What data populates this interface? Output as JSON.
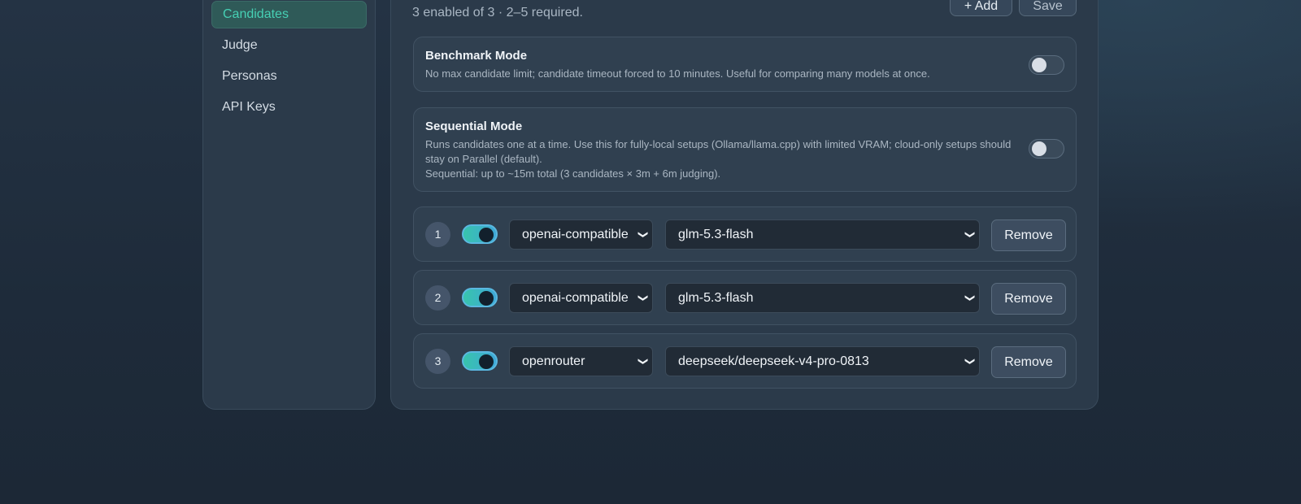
{
  "sidebar": {
    "items": [
      {
        "label": "Candidates",
        "active": true
      },
      {
        "label": "Judge"
      },
      {
        "label": "Personas"
      },
      {
        "label": "API Keys"
      }
    ]
  },
  "header": {
    "summary": "3 enabled of 3 · 2–5 required.",
    "add_label": "+ Add",
    "save_label": "Save"
  },
  "benchmark_mode": {
    "title": "Benchmark Mode",
    "description": "No max candidate limit; candidate timeout forced to 10 minutes. Useful for comparing many models at once.",
    "enabled": false
  },
  "sequential_mode": {
    "title": "Sequential Mode",
    "description": "Runs candidates one at a time. Use this for fully-local setups (Ollama/llama.cpp) with limited VRAM; cloud-only setups should stay on Parallel (default).",
    "estimate": "Sequential: up to ~15m total (3 candidates × 3m + 6m judging).",
    "enabled": false
  },
  "candidates": [
    {
      "number": "1",
      "enabled": true,
      "provider": "openai-compatible",
      "model": "glm-5.3-flash",
      "remove_label": "Remove"
    },
    {
      "number": "2",
      "enabled": true,
      "provider": "openai-compatible",
      "model": "glm-5.3-flash",
      "remove_label": "Remove"
    },
    {
      "number": "3",
      "enabled": true,
      "provider": "openrouter",
      "model": "deepseek/deepseek-v4-pro-0813",
      "remove_label": "Remove"
    }
  ],
  "colors": {
    "accent": "#46d0b4",
    "toggle_on": "#38c4ac",
    "panel": "#2b3a4a",
    "card": "#304050"
  }
}
